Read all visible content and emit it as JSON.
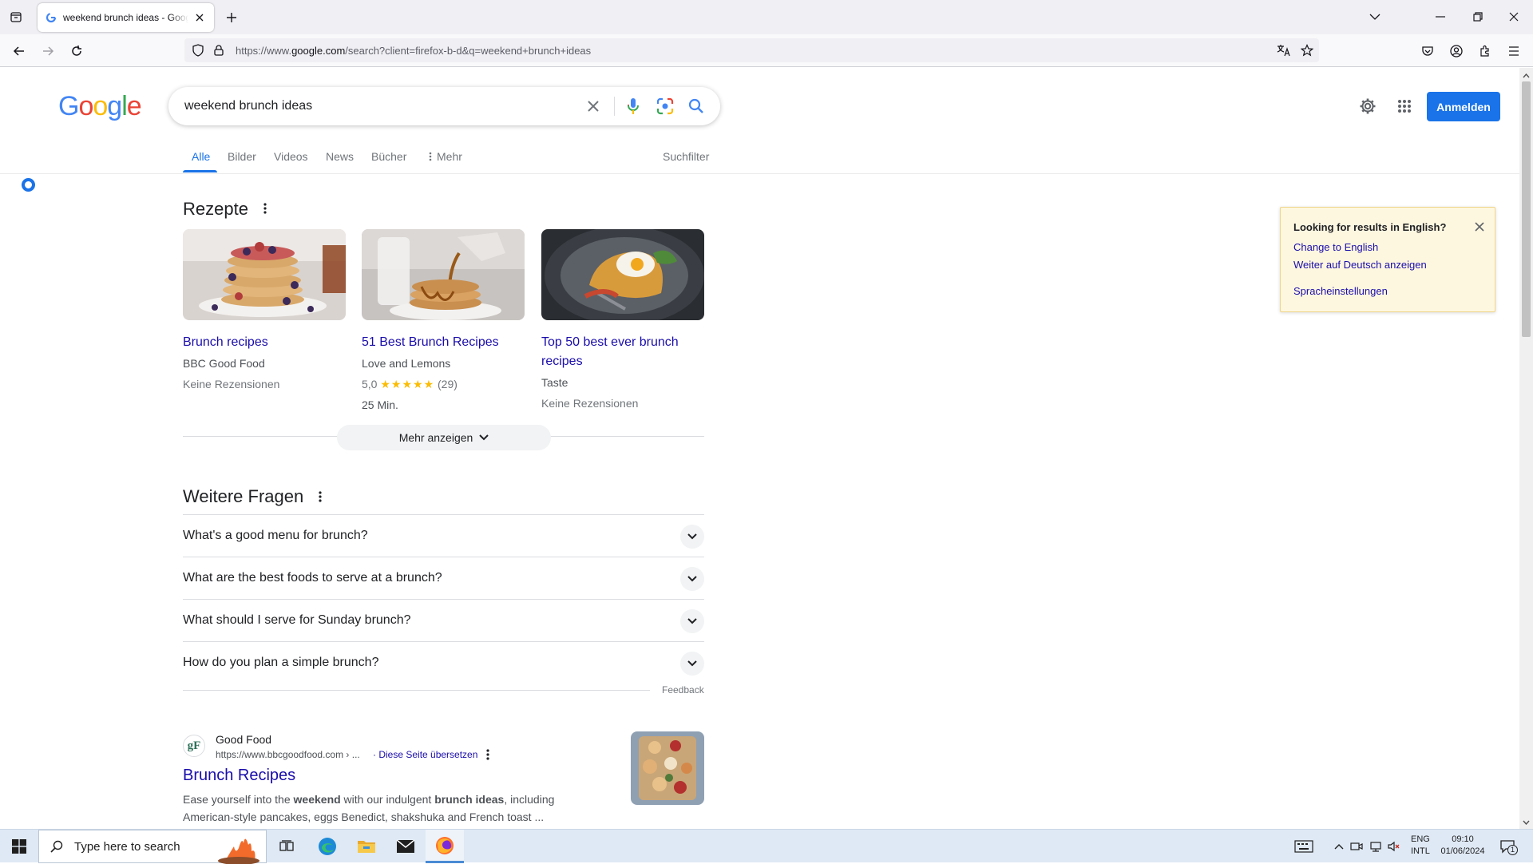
{
  "browser": {
    "tab_title": "weekend brunch ideas - Google Search",
    "url_prefix": "https://www.",
    "url_host": "google.com",
    "url_rest": "/search?client=firefox-b-d&q=weekend+brunch+ideas"
  },
  "google": {
    "query": "weekend brunch ideas",
    "signin": "Anmelden",
    "tabs": [
      "Alle",
      "Bilder",
      "Videos",
      "News",
      "Bücher",
      "Mehr"
    ],
    "tools": "Suchfilter"
  },
  "recipes": {
    "title": "Rezepte",
    "cards": [
      {
        "title": "Brunch recipes",
        "source": "BBC Good Food",
        "rating": "Keine Rezensionen",
        "time": ""
      },
      {
        "title": "51 Best Brunch Recipes",
        "source": "Love and Lemons",
        "rating_value": "5,0",
        "stars": "★★★★★",
        "rating_count": "(29)",
        "time": "25 Min."
      },
      {
        "title": "Top 50 best ever brunch recipes",
        "source": "Taste",
        "rating": "Keine Rezensionen",
        "time": ""
      }
    ],
    "more": "Mehr anzeigen"
  },
  "paa": {
    "title": "Weitere Fragen",
    "questions": [
      "What's a good menu for brunch?",
      "What are the best foods to serve at a brunch?",
      "What should I serve for Sunday brunch?",
      "How do you plan a simple brunch?"
    ],
    "feedback": "Feedback"
  },
  "result": {
    "icon_text": "gF",
    "site": "Good Food",
    "url": "https://www.bbcgoodfood.com › ...",
    "translate": "· Diese Seite übersetzen",
    "title": "Brunch Recipes",
    "snippet_1": "Ease yourself into the ",
    "snippet_b1": "weekend",
    "snippet_2": " with our indulgent ",
    "snippet_b2": "brunch ideas",
    "snippet_3": ", including American-style pancakes, eggs Benedict, shakshuka and French toast ..."
  },
  "lang_popup": {
    "title": "Looking for results in English?",
    "link1": "Change to English",
    "link2": "Weiter auf Deutsch anzeigen",
    "link3": "Spracheinstellungen"
  },
  "taskbar": {
    "search_placeholder": "Type here to search",
    "lang1": "ENG",
    "lang2": "INTL",
    "time": "09:10",
    "date": "01/06/2024",
    "notif_count": "1"
  },
  "colors": {
    "google_blue": "#1a73e8",
    "link": "#1a0dab",
    "popup_bg": "#fef7e0",
    "star": "#fbbc04"
  }
}
